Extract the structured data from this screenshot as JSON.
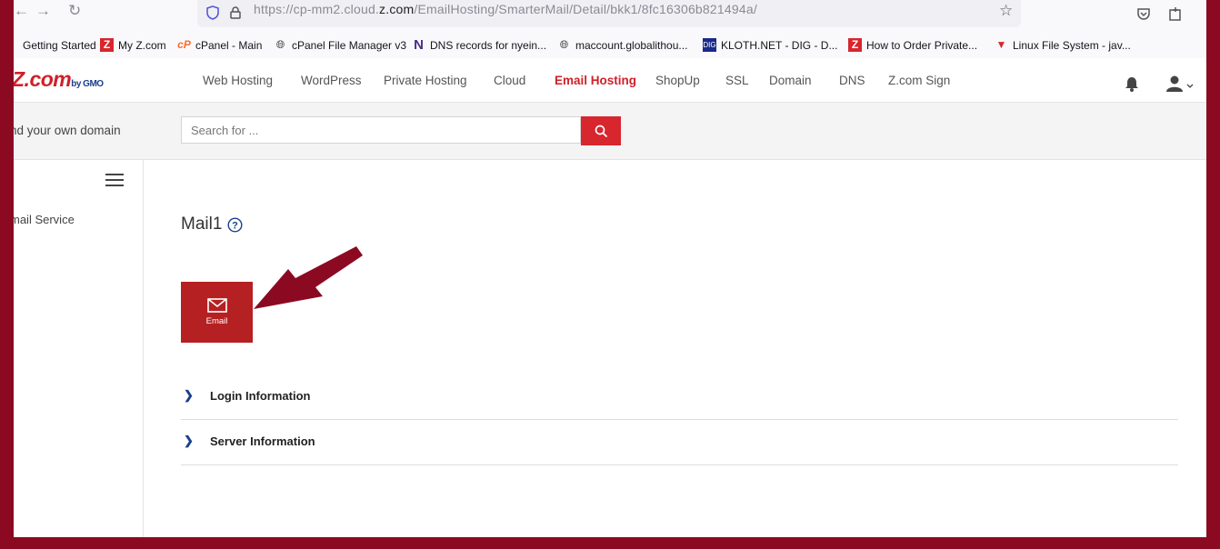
{
  "browser": {
    "url_prefix": "https://cp-mm2.cloud.",
    "url_domain": "z.com",
    "url_path": "/EmailHosting/SmarterMail/Detail/bkk1/8fc16306b821494a/",
    "bookmarks": [
      {
        "label": "Getting Started",
        "icon": "firefox-icon"
      },
      {
        "label": "My Z.com",
        "icon": "zcom-icon"
      },
      {
        "label": "cPanel - Main",
        "icon": "cpanel-icon"
      },
      {
        "label": "cPanel File Manager v3",
        "icon": "globe-icon"
      },
      {
        "label": "DNS records for nyein...",
        "icon": "n-icon"
      },
      {
        "label": "maccount.globalithou...",
        "icon": "globe-icon"
      },
      {
        "label": "KLOTH.NET - DIG - D...",
        "icon": "kloth-icon"
      },
      {
        "label": "How to Order Private...",
        "icon": "zcom-icon"
      },
      {
        "label": "Linux File System - jav...",
        "icon": "triangle-icon"
      }
    ]
  },
  "header": {
    "logo_main": "Z.com",
    "logo_sub": "by GMO",
    "nav": [
      "Web Hosting",
      "WordPress",
      "Private Hosting",
      "Cloud",
      "Email Hosting",
      "ShopUp",
      "SSL",
      "Domain",
      "DNS",
      "Z.com Sign"
    ],
    "active_nav": "Email Hosting"
  },
  "search": {
    "domain_text": "nd your own domain",
    "placeholder": "Search for ..."
  },
  "sidebar": {
    "item": "mail Service"
  },
  "main": {
    "title": "Mail1",
    "tile_label": "Email",
    "sections": [
      "Login Information",
      "Server Information"
    ]
  },
  "colors": {
    "brand_red": "#d7262e",
    "tile_red": "#b52022",
    "frame_maroon": "#8b0a22",
    "arrow": "#8b0a22"
  }
}
